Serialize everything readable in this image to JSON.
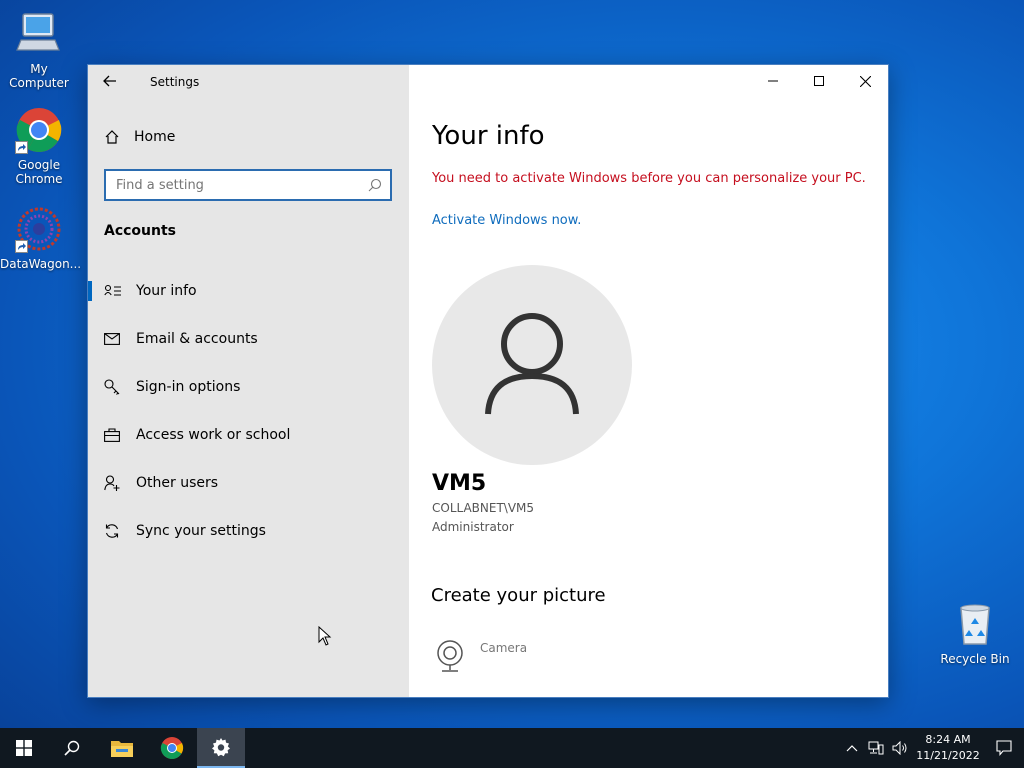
{
  "desktop": {
    "icons": [
      {
        "label": "My Computer"
      },
      {
        "label": "Google Chrome"
      },
      {
        "label": "DataWagon..."
      },
      {
        "label": "Recycle Bin"
      }
    ]
  },
  "window": {
    "title": "Settings",
    "home_label": "Home",
    "search_placeholder": "Find a setting",
    "section_heading": "Accounts",
    "nav_items": [
      {
        "label": "Your info",
        "icon": "contact-card-icon",
        "selected": true
      },
      {
        "label": "Email & accounts",
        "icon": "mail-icon",
        "selected": false
      },
      {
        "label": "Sign-in options",
        "icon": "key-icon",
        "selected": false
      },
      {
        "label": "Access work or school",
        "icon": "briefcase-icon",
        "selected": false
      },
      {
        "label": "Other users",
        "icon": "add-person-icon",
        "selected": false
      },
      {
        "label": "Sync your settings",
        "icon": "sync-icon",
        "selected": false
      }
    ]
  },
  "content": {
    "title": "Your info",
    "warning": "You need to activate Windows before you can personalize your PC.",
    "activate_link": "Activate Windows now.",
    "user_name": "VM5",
    "user_domain": "COLLABNET\\VM5",
    "user_role": "Administrator",
    "create_picture_title": "Create your picture",
    "camera_label": "Camera"
  },
  "taskbar": {
    "time": "8:24 AM",
    "date": "11/21/2022"
  },
  "colors": {
    "accent": "#0067c0",
    "warning_red": "#c50f1f",
    "link_blue": "#0f6cbd",
    "sidebar_bg": "#e6e6e6",
    "taskbar_bg": "#101820"
  }
}
